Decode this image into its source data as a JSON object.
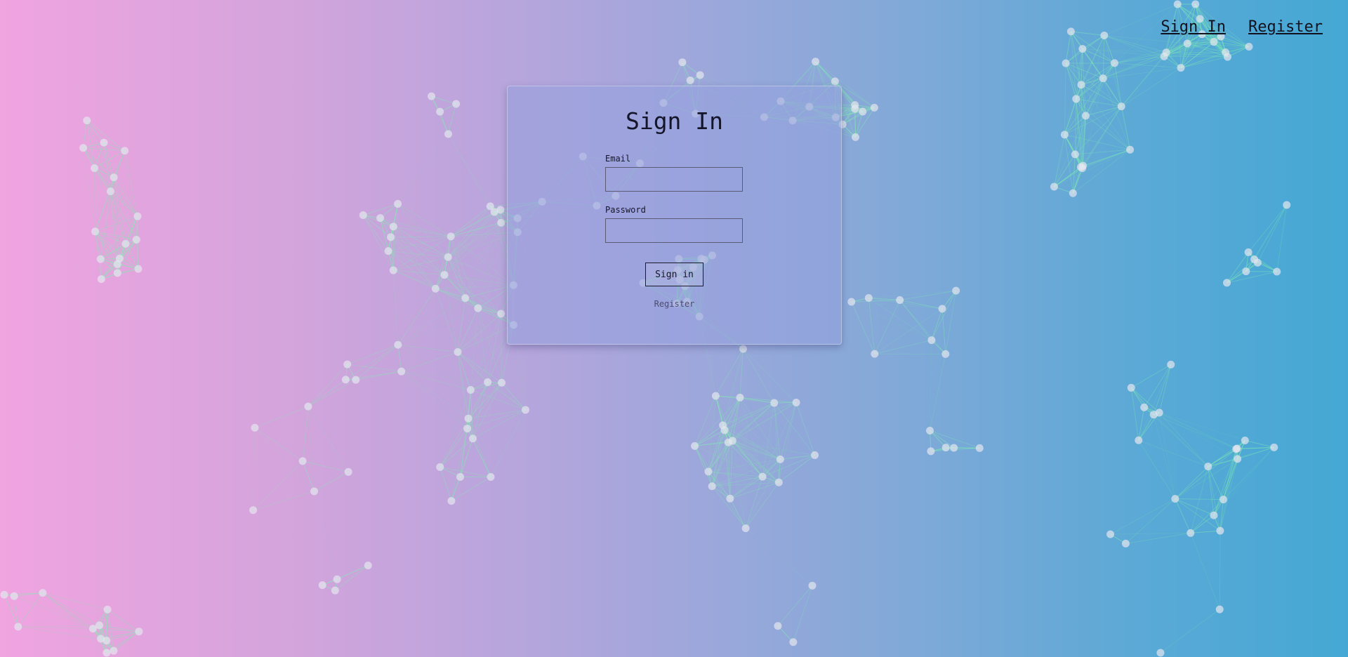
{
  "nav": {
    "sign_in": "Sign In",
    "register": "Register"
  },
  "form": {
    "title": "Sign In",
    "email_label": "Email",
    "email_value": "",
    "password_label": "Password",
    "password_value": "",
    "submit_label": "Sign in",
    "register_link": "Register"
  },
  "colors": {
    "gradient_left": "#f0a4e0",
    "gradient_right": "#45a8d4",
    "network_line": "#7ef0b0",
    "network_node": "#e6e6f0"
  }
}
